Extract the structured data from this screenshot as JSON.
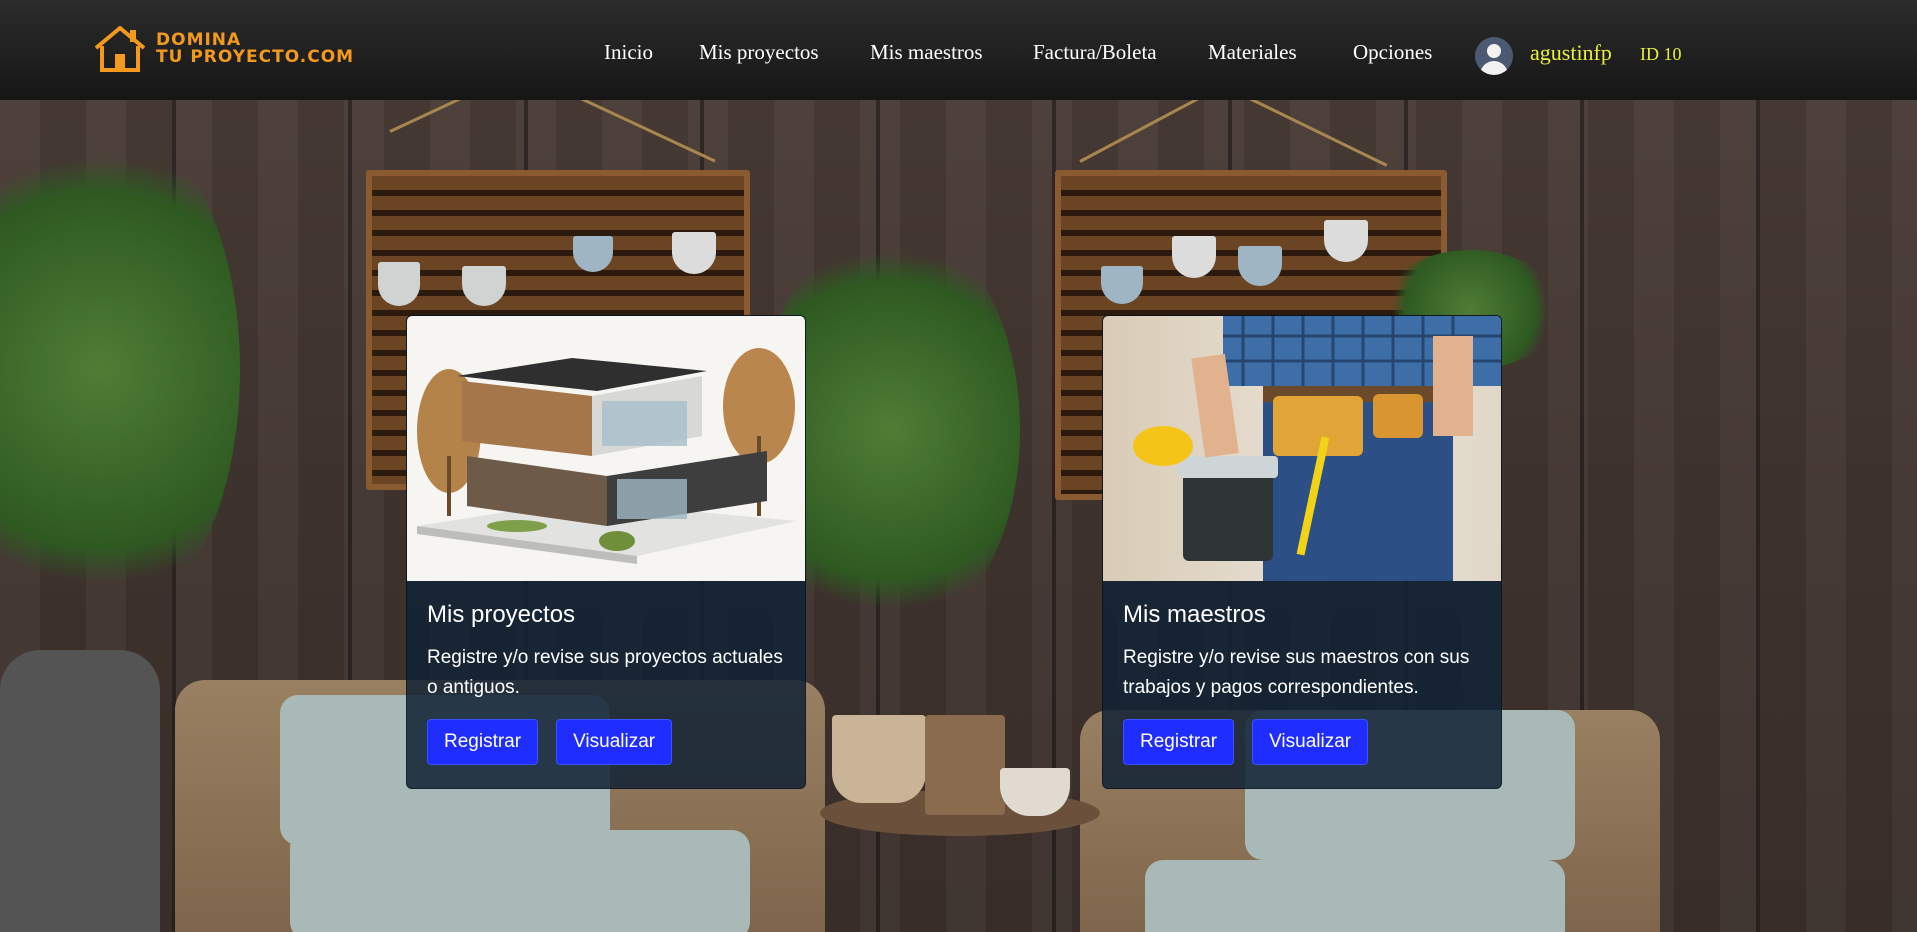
{
  "brand": {
    "line1": "DOMINA",
    "line2": "TU PROYECTO.COM",
    "color": "#f39a1e"
  },
  "nav": {
    "items": [
      {
        "label": "Inicio"
      },
      {
        "label": "Mis proyectos"
      },
      {
        "label": "Mis maestros"
      },
      {
        "label": "Factura/Boleta"
      },
      {
        "label": "Materiales"
      },
      {
        "label": "Opciones"
      }
    ]
  },
  "user": {
    "name": "agustinfp",
    "id_label": "ID 10",
    "accent": "#e9ef3a"
  },
  "cards": [
    {
      "title": "Mis proyectos",
      "text": "Registre y/o revise sus proyectos actuales o antiguos.",
      "buttons": [
        "Registrar",
        "Visualizar"
      ],
      "image": "modern-house-image"
    },
    {
      "title": "Mis maestros",
      "text": "Registre y/o revise sus maestros con sus trabajos y pagos correspondientes.",
      "buttons": [
        "Registrar",
        "Visualizar"
      ],
      "image": "worker-toolbelt-image"
    }
  ],
  "colors": {
    "button": "#1f2dff",
    "card_bg": "#102234",
    "navbar": "#1a1a1a"
  }
}
